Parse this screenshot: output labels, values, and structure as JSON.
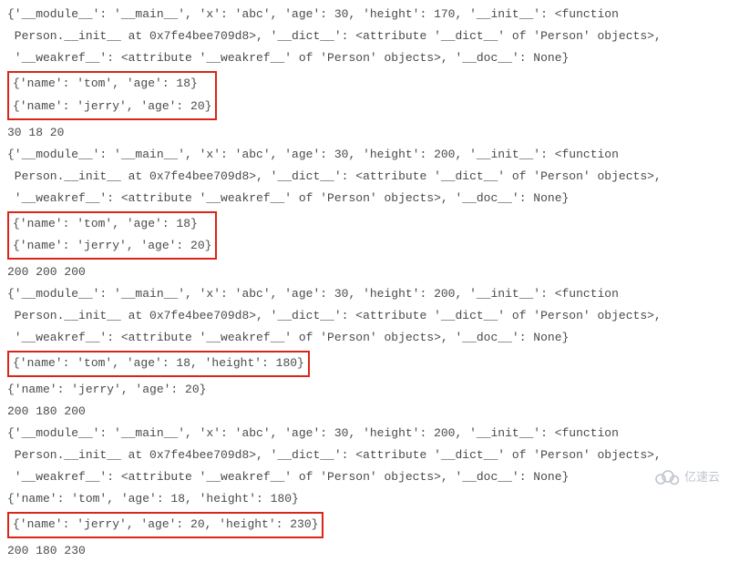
{
  "block1": {
    "l1": "{'__module__': '__main__', 'x': 'abc', 'age': 30, 'height': 170, '__init__': <function",
    "l2": " Person.__init__ at 0x7fe4bee709d8>, '__dict__': <attribute '__dict__' of 'Person' objects>,",
    "l3": " '__weakref__': <attribute '__weakref__' of 'Person' objects>, '__doc__': None}",
    "box": {
      "b1": "{'name': 'tom', 'age': 18}",
      "b2": "{'name': 'jerry', 'age': 20}"
    },
    "after": "30 18 20"
  },
  "block2": {
    "l1": "{'__module__': '__main__', 'x': 'abc', 'age': 30, 'height': 200, '__init__': <function",
    "l2": " Person.__init__ at 0x7fe4bee709d8>, '__dict__': <attribute '__dict__' of 'Person' objects>,",
    "l3": " '__weakref__': <attribute '__weakref__' of 'Person' objects>, '__doc__': None}",
    "box": {
      "b1": "{'name': 'tom', 'age': 18}",
      "b2": "{'name': 'jerry', 'age': 20}"
    },
    "after": "200 200 200"
  },
  "block3": {
    "l1": "{'__module__': '__main__', 'x': 'abc', 'age': 30, 'height': 200, '__init__': <function",
    "l2": " Person.__init__ at 0x7fe4bee709d8>, '__dict__': <attribute '__dict__' of 'Person' objects>,",
    "l3": " '__weakref__': <attribute '__weakref__' of 'Person' objects>, '__doc__': None}",
    "box": {
      "b1": "{'name': 'tom', 'age': 18, 'height': 180}"
    },
    "after1": "{'name': 'jerry', 'age': 20}",
    "after2": "200 180 200"
  },
  "block4": {
    "l1": "{'__module__': '__main__', 'x': 'abc', 'age': 30, 'height': 200, '__init__': <function",
    "l2": " Person.__init__ at 0x7fe4bee709d8>, '__dict__': <attribute '__dict__' of 'Person' objects>,",
    "l3": " '__weakref__': <attribute '__weakref__' of 'Person' objects>, '__doc__': None}",
    "after0": "{'name': 'tom', 'age': 18, 'height': 180}",
    "box": {
      "b1": "{'name': 'jerry', 'age': 20, 'height': 230}"
    },
    "after1": "200 180 230"
  },
  "watermark": "亿速云"
}
